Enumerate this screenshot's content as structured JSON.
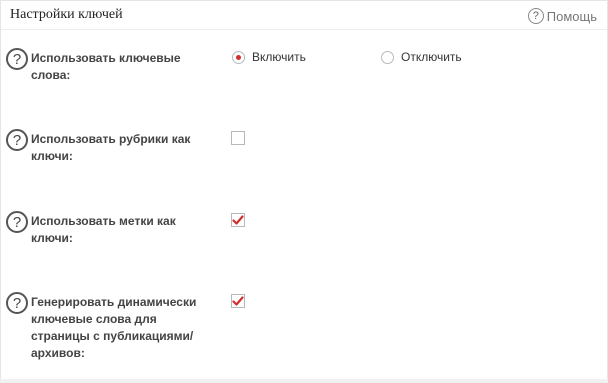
{
  "header": {
    "title": "Настройки ключей",
    "help_label": "Помощь"
  },
  "settings": [
    {
      "label": "Использовать ключевые слова:",
      "type": "radio",
      "options": [
        {
          "label": "Включить",
          "selected": true
        },
        {
          "label": "Отключить",
          "selected": false
        }
      ]
    },
    {
      "label": "Использовать рубрики как ключи:",
      "type": "checkbox",
      "checked": false
    },
    {
      "label": "Использовать метки как ключи:",
      "type": "checkbox",
      "checked": true
    },
    {
      "label": "Генерировать динамически ключевые слова для страницы с публикациями/архивов:",
      "type": "checkbox",
      "checked": true
    }
  ],
  "colors": {
    "accent": "#d42f2f",
    "border": "#b4b9be"
  },
  "icons": {
    "help": "question-circle-icon",
    "check": "checkmark-icon"
  }
}
